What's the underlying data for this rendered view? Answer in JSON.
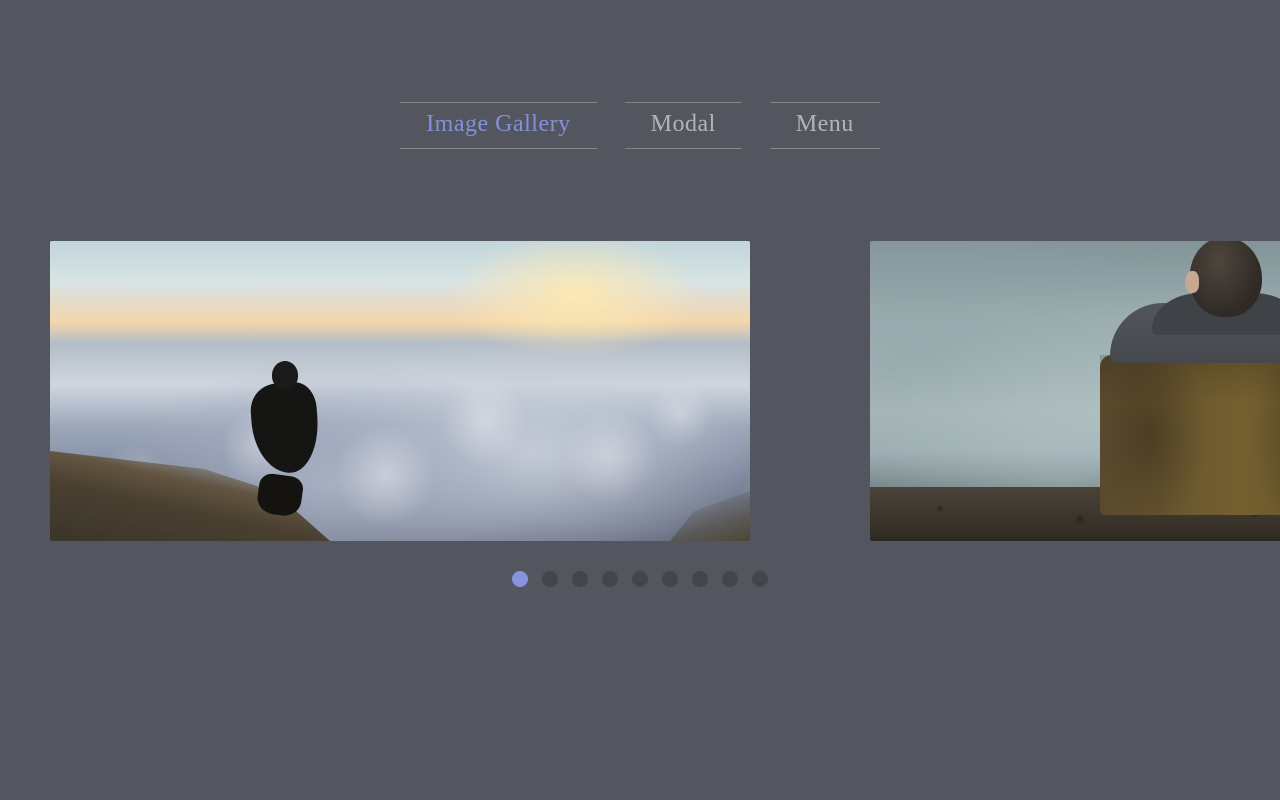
{
  "tabs": [
    {
      "label": "Image Gallery",
      "active": true
    },
    {
      "label": "Modal",
      "active": false
    },
    {
      "label": "Menu",
      "active": false
    }
  ],
  "gallery": {
    "current_index": 0,
    "total_slides": 9,
    "slides": [
      {
        "alt": "person crouching on rock above sea of clouds at sunset"
      },
      {
        "alt": "person in jacket viewed from behind overlooking hazy city"
      }
    ]
  },
  "colors": {
    "background": "#54565f",
    "accent": "#8490d9",
    "tab_text": "rgba(255,255,255,0.55)",
    "dot_inactive": "#43454d",
    "dot_active": "#8793dd"
  }
}
